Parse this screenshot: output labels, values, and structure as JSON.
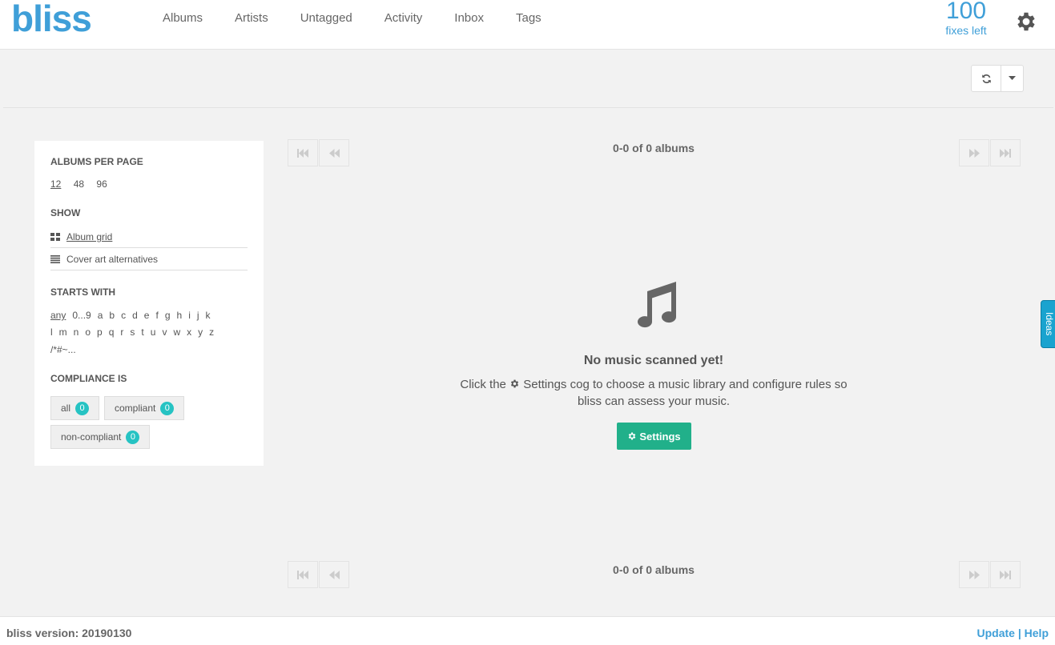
{
  "brand": {
    "logo": "bliss",
    "accent": "#3f9fd8"
  },
  "nav": {
    "items": [
      "Albums",
      "Artists",
      "Untagged",
      "Activity",
      "Inbox",
      "Tags"
    ]
  },
  "fixes": {
    "count": "100",
    "label": "fixes left"
  },
  "sidebar": {
    "per_page_heading": "ALBUMS PER PAGE",
    "per_page_options": [
      "12",
      "48",
      "96"
    ],
    "show_heading": "SHOW",
    "show_items": [
      "Album grid",
      "Cover art alternatives"
    ],
    "starts_with_heading": "STARTS WITH",
    "letters_row1": [
      "any",
      "0...9",
      "a",
      "b",
      "c",
      "d",
      "e",
      "f",
      "g",
      "h",
      "i",
      "j",
      "k"
    ],
    "letters_row2": [
      "l",
      "m",
      "n",
      "o",
      "p",
      "q",
      "r",
      "s",
      "t",
      "u",
      "v",
      "w",
      "x",
      "y",
      "z"
    ],
    "letters_row3": [
      "/*#~..."
    ],
    "compliance_heading": "COMPLIANCE IS",
    "compliance": [
      {
        "label": "all",
        "count": "0"
      },
      {
        "label": "compliant",
        "count": "0"
      },
      {
        "label": "non-compliant",
        "count": "0"
      }
    ]
  },
  "pager": {
    "text": "0-0 of 0 albums"
  },
  "empty": {
    "title": "No music scanned yet!",
    "desc_prefix": "Click the",
    "desc_suffix": "Settings cog to choose a music library and configure rules so bliss can assess your music.",
    "button": "Settings"
  },
  "ideas_tab": "Ideas",
  "footer": {
    "version": "bliss version: 20190130",
    "update": "Update",
    "separator": "|",
    "help": "Help"
  }
}
